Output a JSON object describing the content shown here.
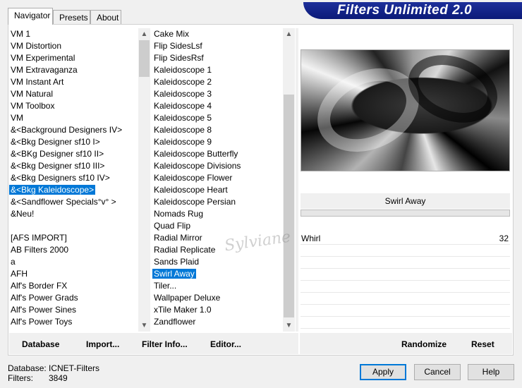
{
  "tabs": [
    {
      "label": "Navigator",
      "active": true
    },
    {
      "label": "Presets",
      "active": false
    },
    {
      "label": "About",
      "active": false
    }
  ],
  "banner_title": "Filters Unlimited 2.0",
  "categories": {
    "selected_index": 13,
    "items": [
      "VM 1",
      "VM Distortion",
      "VM Experimental",
      "VM Extravaganza",
      "VM Instant Art",
      "VM Natural",
      "VM Toolbox",
      "VM",
      "&<Background Designers IV>",
      "&<Bkg Designer sf10 I>",
      "&<BKg Designer sf10 II>",
      "&<Bkg Designer sf10 III>",
      "&<Bkg Designers sf10 IV>",
      "&<Bkg Kaleidoscope>",
      "&<Sandflower Specials°v° >",
      "&Neu!",
      "",
      "[AFS IMPORT]",
      "AB Filters 2000",
      "a",
      "AFH",
      "Alf's Border FX",
      "Alf's Power Grads",
      "Alf's Power Sines",
      "Alf's Power Toys"
    ]
  },
  "filters": {
    "selected_index": 20,
    "items": [
      "Cake Mix",
      "Flip SidesLsf",
      "Flip SidesRsf",
      "Kaleidoscope 1",
      "Kaleidoscope 2",
      "Kaleidoscope 3",
      "Kaleidoscope 4",
      "Kaleidoscope 5",
      "Kaleidoscope 8",
      "Kaleidoscope 9",
      "Kaleidoscope Butterfly",
      "Kaleidoscope Divisions",
      "Kaleidoscope Flower",
      "Kaleidoscope Heart",
      "Kaleidoscope Persian",
      "Nomads Rug",
      "Quad Flip",
      "Radial Mirror",
      "Radial Replicate",
      "Sands Plaid",
      "Swirl Away",
      "Tiler...",
      "Wallpaper Deluxe",
      "xTile Maker 1.0",
      "Zandflower"
    ]
  },
  "current_filter_name": "Swirl Away",
  "parameters": [
    {
      "label": "Whirl",
      "value": "32"
    }
  ],
  "panel_buttons": {
    "database": "Database",
    "import": "Import...",
    "filter_info": "Filter Info...",
    "editor": "Editor...",
    "randomize": "Randomize",
    "reset": "Reset"
  },
  "status": {
    "database_label": "Database:",
    "database_value": "ICNET-Filters",
    "filters_label": "Filters:",
    "filters_value": "3849"
  },
  "dialog_buttons": {
    "apply": "Apply",
    "cancel": "Cancel",
    "help": "Help"
  },
  "watermark_text": "Sylviane",
  "icons": {
    "scroll_up": "▲",
    "scroll_down": "▼"
  }
}
